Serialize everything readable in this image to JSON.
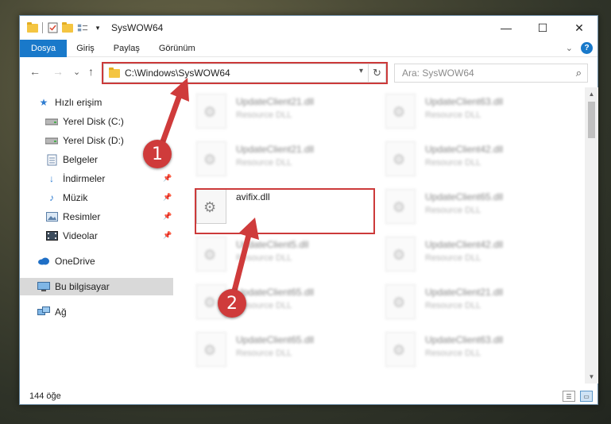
{
  "window": {
    "title": "SysWOW64",
    "controls": {
      "minimize": "—",
      "maximize": "☐",
      "close": "✕"
    }
  },
  "ribbon": {
    "tabs": [
      "Dosya",
      "Giriş",
      "Paylaş",
      "Görünüm"
    ],
    "active_tab": "Dosya",
    "help": "?"
  },
  "navigation": {
    "back": "←",
    "forward": "→",
    "recent": "⌄",
    "up": "↑",
    "address": "C:\\Windows\\SysWOW64",
    "search_placeholder": "Ara: SysWOW64"
  },
  "sidebar": {
    "items": [
      {
        "label": "Hızlı erişim",
        "icon": "star-icon",
        "pinned": false
      },
      {
        "label": "Yerel Disk (C:)",
        "icon": "drive-icon",
        "pinned": false
      },
      {
        "label": "Yerel Disk (D:)",
        "icon": "drive-icon",
        "pinned": false
      },
      {
        "label": "Belgeler",
        "icon": "documents-icon",
        "pinned": true
      },
      {
        "label": "İndirmeler",
        "icon": "download-icon",
        "pinned": true
      },
      {
        "label": "Müzik",
        "icon": "music-icon",
        "pinned": true
      },
      {
        "label": "Resimler",
        "icon": "pictures-icon",
        "pinned": true
      },
      {
        "label": "Videolar",
        "icon": "videos-icon",
        "pinned": true
      },
      {
        "label": "OneDrive",
        "icon": "cloud-icon",
        "pinned": false
      },
      {
        "label": "Bu bilgisayar",
        "icon": "computer-icon",
        "pinned": false,
        "selected": true
      },
      {
        "label": "Ağ",
        "icon": "network-icon",
        "pinned": false
      }
    ]
  },
  "files": {
    "left": [
      {
        "name": "UpdateClient21.dll",
        "type": "Resource DLL"
      },
      {
        "name": "UpdateClient21.dll",
        "type": "Resource DLL"
      },
      {
        "name": "avifix.dll",
        "type": ""
      },
      {
        "name": "UpdateClient5.dll",
        "type": "Resource DLL"
      },
      {
        "name": "UpdateClient65.dll",
        "type": "Resource DLL"
      },
      {
        "name": "UpdateClient65.dll",
        "type": "Resource DLL"
      }
    ],
    "right": [
      {
        "name": "UpdateClient63.dll",
        "type": "Resource DLL"
      },
      {
        "name": "UpdateClient42.dll",
        "type": "Resource DLL"
      },
      {
        "name": "UpdateClient65.dll",
        "type": "Resource DLL"
      },
      {
        "name": "UpdateClient42.dll",
        "type": "Resource DLL"
      },
      {
        "name": "UpdateClient21.dll",
        "type": "Resource DLL"
      },
      {
        "name": "UpdateClient63.dll",
        "type": "Resource DLL"
      }
    ]
  },
  "status": {
    "count": "144 öğe"
  },
  "callouts": [
    "1",
    "2"
  ],
  "colors": {
    "accent": "#1979ca",
    "highlight": "#cc3a3a",
    "folder": "#f4c542"
  }
}
